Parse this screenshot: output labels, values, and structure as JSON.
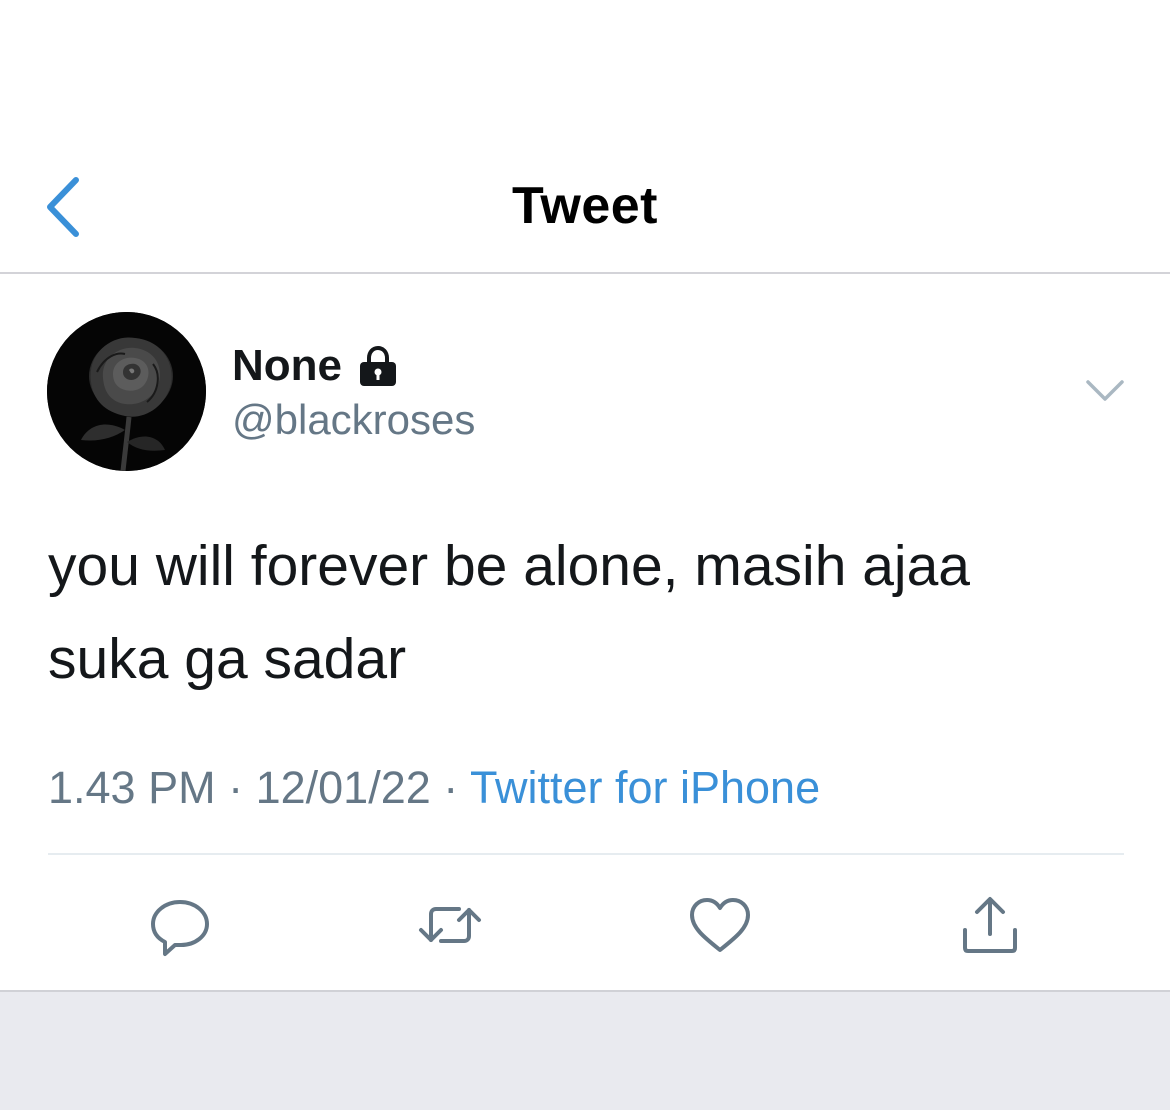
{
  "nav": {
    "title": "Tweet",
    "back_icon": "chevron-left-icon"
  },
  "tweet": {
    "display_name": "None",
    "protected_icon": "lock-icon",
    "handle": "@blackroses",
    "avatar": "black-rose-avatar",
    "text": "you will forever be alone, masih ajaa\nsuka ga sadar",
    "time": "1.43 PM",
    "separator": " · ",
    "date": "12/01/22",
    "source": "Twitter for iPhone"
  },
  "actions": [
    {
      "name": "reply",
      "icon": "reply-icon"
    },
    {
      "name": "retweet",
      "icon": "retweet-icon"
    },
    {
      "name": "like",
      "icon": "heart-icon"
    },
    {
      "name": "share",
      "icon": "share-icon"
    }
  ],
  "colors": {
    "accent": "#3a90d8",
    "secondary_text": "#657786",
    "primary_text": "#14171a",
    "icon_gray": "#657786"
  }
}
